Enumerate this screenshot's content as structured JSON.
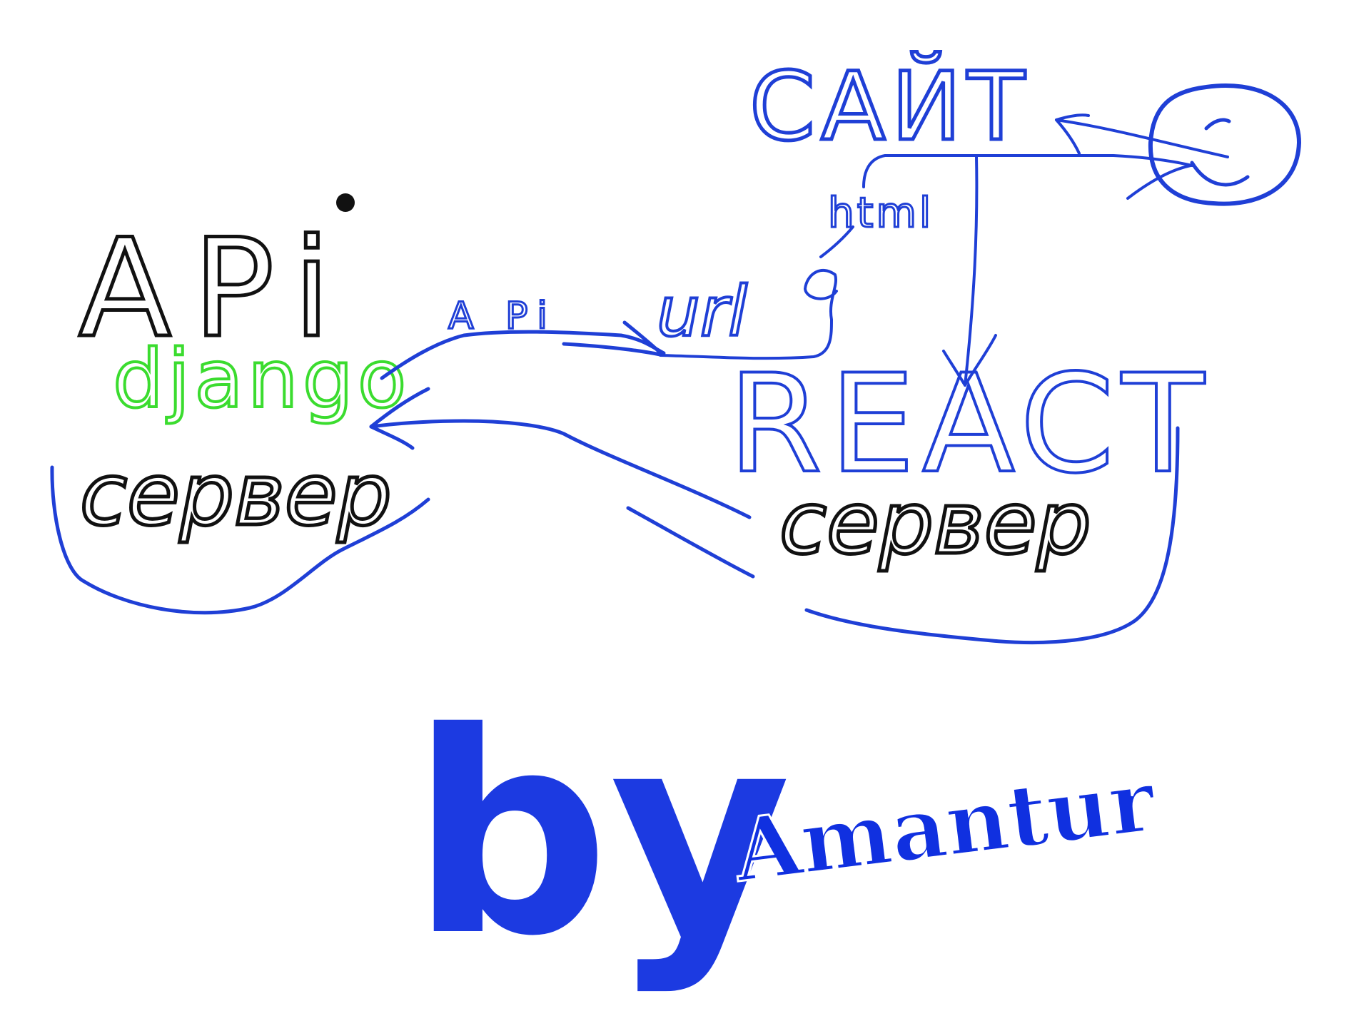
{
  "labels": {
    "api": "APi",
    "django": "django",
    "server_left": "сервер",
    "server_right": "сервер",
    "react": "REACT",
    "site": "САЙТ",
    "arrow_api": "A Pi",
    "url": "url",
    "html": "html"
  },
  "credit": {
    "by": "by",
    "author": "Amantur"
  },
  "colors": {
    "ink_black": "#111111",
    "ink_blue": "#1f3fd6",
    "ink_green": "#3bdc2f",
    "credit_blue": "#1030e0"
  }
}
